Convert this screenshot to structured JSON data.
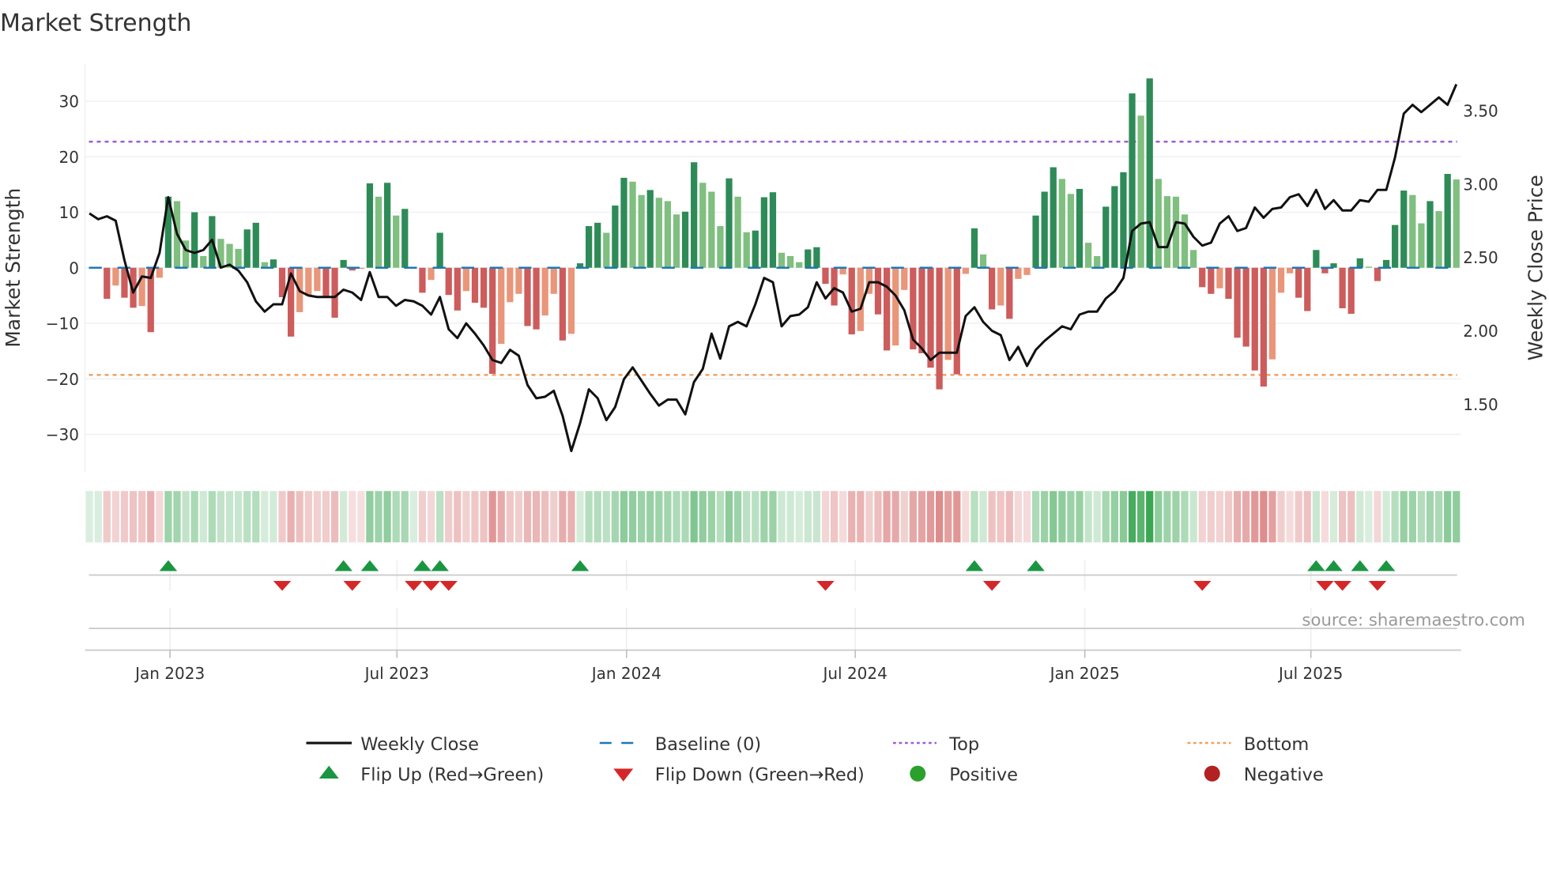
{
  "chart_data": {
    "type": "bar",
    "title": "Market Strength",
    "ylabel": "Market Strength",
    "y2label": "Weekly Close Price",
    "ylim": [
      -37,
      37
    ],
    "y2lim": [
      1.0,
      3.83
    ],
    "y_ticks": [
      30,
      20,
      10,
      0,
      -10,
      -20,
      -30
    ],
    "y_tick_labels": [
      "30",
      "20",
      "10",
      "0",
      "−10",
      "−20",
      "−30"
    ],
    "y2_ticks": [
      3.5,
      3.0,
      2.5,
      2.0,
      1.5
    ],
    "y2_tick_labels": [
      "3.50",
      "3.00",
      "2.50",
      "2.00",
      "1.50"
    ],
    "x_ticks": [
      {
        "week": 9.2,
        "label": "Jan 2023"
      },
      {
        "week": 35.1,
        "label": "Jul 2023"
      },
      {
        "week": 61.3,
        "label": "Jan 2024"
      },
      {
        "week": 87.4,
        "label": "Jul 2024"
      },
      {
        "week": 113.6,
        "label": "Jan 2025"
      },
      {
        "week": 139.4,
        "label": "Jul 2025"
      }
    ],
    "grid": true,
    "top_level": 22.7,
    "bottom_level": -19.3,
    "baseline": 0,
    "strength": [
      0,
      0,
      -5.6,
      -3.2,
      -5.4,
      -7.2,
      -6.9,
      -11.6,
      -1.8,
      12.8,
      12,
      4.9,
      10,
      2.1,
      9.3,
      5.2,
      4.3,
      3.4,
      6.9,
      8.1,
      1,
      1.5,
      -5.3,
      -12.4,
      -8,
      -5.1,
      -4.2,
      -5.1,
      -9,
      1.4,
      -0.5,
      -0.2,
      15.2,
      12.8,
      15.3,
      9.4,
      10.6,
      0,
      -4.5,
      -2.2,
      6.3,
      -4.9,
      -7.7,
      -4.2,
      -6.3,
      -7.2,
      -19.1,
      -13.7,
      -6.2,
      -4.7,
      -10.5,
      -11.1,
      -8.6,
      -4.7,
      -13.1,
      -11.9,
      0.8,
      7.5,
      8.1,
      6.3,
      11.2,
      16.2,
      15.5,
      13.1,
      14,
      12.6,
      12,
      9.6,
      10.1,
      19,
      15.3,
      13.7,
      7.5,
      16.1,
      12.8,
      6.4,
      6.7,
      12.7,
      13.6,
      2.7,
      2.1,
      1,
      3.3,
      3.7,
      -2.9,
      -6.8,
      -1.2,
      -12,
      -11.4,
      -4.7,
      -8.4,
      -14.9,
      -14,
      -4,
      -14.7,
      -15.4,
      -18,
      -21.9,
      -16.6,
      -19.2,
      -1.1,
      7.1,
      2.4,
      -7.5,
      -6.8,
      -9.2,
      -2,
      -1.3,
      9.4,
      13.7,
      18.1,
      16,
      13.3,
      14.2,
      4.5,
      2.1,
      11,
      14.7,
      17.2,
      31.4,
      27.4,
      34.1,
      16,
      12.9,
      12.8,
      9.6,
      3.2,
      -3.5,
      -4.7,
      -3.7,
      -5.6,
      -12.6,
      -14.2,
      -18.5,
      -21.4,
      -16.5,
      -4.5,
      -1,
      -5.4,
      -7.8,
      3.2,
      -1,
      0.8,
      -7.3,
      -8.3,
      1.7,
      0.2,
      -2.4,
      1.4,
      7.7,
      13.9,
      13.1,
      8,
      12,
      10.2,
      16.9,
      15.9
    ],
    "weekly_close": [
      2.8,
      2.76,
      2.78,
      2.75,
      2.48,
      2.26,
      2.37,
      2.36,
      2.53,
      2.91,
      2.66,
      2.55,
      2.53,
      2.55,
      2.62,
      2.43,
      2.45,
      2.41,
      2.33,
      2.2,
      2.13,
      2.18,
      2.18,
      2.39,
      2.27,
      2.24,
      2.23,
      2.23,
      2.23,
      2.28,
      2.26,
      2.21,
      2.4,
      2.23,
      2.23,
      2.17,
      2.21,
      2.2,
      2.17,
      2.11,
      2.23,
      2.01,
      1.95,
      2.05,
      1.98,
      1.9,
      1.8,
      1.78,
      1.87,
      1.83,
      1.63,
      1.54,
      1.55,
      1.59,
      1.42,
      1.18,
      1.37,
      1.6,
      1.54,
      1.39,
      1.48,
      1.67,
      1.75,
      1.66,
      1.57,
      1.49,
      1.53,
      1.53,
      1.43,
      1.65,
      1.74,
      1.98,
      1.81,
      2.03,
      2.06,
      2.03,
      2.18,
      2.36,
      2.33,
      2.03,
      2.1,
      2.11,
      2.16,
      2.33,
      2.22,
      2.29,
      2.26,
      2.13,
      2.15,
      2.33,
      2.33,
      2.3,
      2.24,
      2.14,
      1.94,
      1.88,
      1.8,
      1.85,
      1.85,
      1.85,
      2.1,
      2.16,
      2.06,
      2.0,
      1.97,
      1.8,
      1.89,
      1.76,
      1.87,
      1.93,
      1.98,
      2.03,
      2.01,
      2.11,
      2.13,
      2.13,
      2.22,
      2.27,
      2.36,
      2.68,
      2.73,
      2.74,
      2.57,
      2.57,
      2.74,
      2.73,
      2.64,
      2.58,
      2.6,
      2.73,
      2.78,
      2.68,
      2.7,
      2.84,
      2.77,
      2.83,
      2.84,
      2.91,
      2.93,
      2.85,
      2.96,
      2.83,
      2.89,
      2.82,
      2.82,
      2.89,
      2.88,
      2.96,
      2.96,
      3.18,
      3.48,
      3.54,
      3.49,
      3.54,
      3.59,
      3.54,
      3.68
    ],
    "flip_up_weeks": [
      9,
      29,
      32,
      38,
      40,
      56,
      101,
      108,
      140,
      142,
      145,
      148
    ],
    "flip_down_weeks": [
      22,
      30,
      37,
      39,
      41,
      84,
      103,
      127,
      141,
      143,
      147
    ],
    "colors": {
      "rising_green": "#2e8b57",
      "falling_green": "#7fbf7f",
      "falling_red": "#cd5c5c",
      "rising_red": "#e9967a",
      "close_line": "#111111",
      "baseline": "#1f77b4",
      "top": "#9c5fd6",
      "bottom": "#f0a060",
      "flip_up": "#1a9641",
      "flip_down": "#d62728",
      "positive": "#2ca02c",
      "negative": "#b22222"
    }
  },
  "legend": [
    {
      "key": "weekly-close",
      "label": "Weekly Close"
    },
    {
      "key": "baseline",
      "label": "Baseline (0)"
    },
    {
      "key": "top",
      "label": "Top"
    },
    {
      "key": "bottom",
      "label": "Bottom"
    },
    {
      "key": "flip-up",
      "label": "Flip Up (Red→Green)"
    },
    {
      "key": "flip-down",
      "label": "Flip Down (Green→Red)"
    },
    {
      "key": "positive",
      "label": "Positive"
    },
    {
      "key": "negative",
      "label": "Negative"
    }
  ],
  "source": "source: sharemaestro.com"
}
